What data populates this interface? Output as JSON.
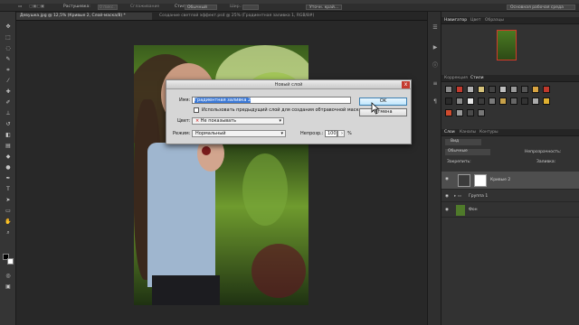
{
  "options_bar": {
    "feather_label": "Растушевка:",
    "feather_value": "0 пикс.",
    "antialias_label": "Сглаживание",
    "style_label": "Стиль:",
    "style_value": "Обычный",
    "width_label": "Шир.:",
    "refine_button": "Уточн. край...",
    "workspace_label": "Основная рабочая среда"
  },
  "tabs": [
    {
      "label": "Девушка.jpg @ 12,5% (Кривые 2, Слой-маска/8) *",
      "active": true
    },
    {
      "label": "Создание светлой эффект.psd @ 25% (Градиентная заливка 1, RGB/8#)",
      "active": false
    }
  ],
  "dialog": {
    "title": "Новый слой",
    "name_label": "Имя:",
    "name_value": "Градиентная заливка 2",
    "checkbox_label": "Использовать предыдущий слой для создания обтравочной маски",
    "color_label": "Цвет:",
    "color_value": "Не показывать",
    "mode_label": "Режим:",
    "mode_value": "Нормальный",
    "opacity_label": "Непрозр.:",
    "opacity_value": "100",
    "opacity_unit": "%",
    "ok_button": "OK",
    "cancel_button": "Отмена",
    "close_symbol": "x"
  },
  "right_panel": {
    "nav_tabs": [
      "Навигатор",
      "Цвет",
      "Образцы"
    ],
    "adj_tabs": [
      "Коррекция",
      "Стили"
    ],
    "layers_tabs": [
      "Слои",
      "Каналы",
      "Контуры"
    ],
    "kind_value": "Вид",
    "blend_value": "Обычные",
    "opacity_label": "Непрозрачность:",
    "lock_label": "Закрепить:",
    "fill_label": "Заливка:",
    "layers": [
      {
        "name": "Кривые 2",
        "active": true
      },
      {
        "name": "Группа 1",
        "active": false
      },
      {
        "name": "Фон",
        "active": false
      }
    ]
  }
}
